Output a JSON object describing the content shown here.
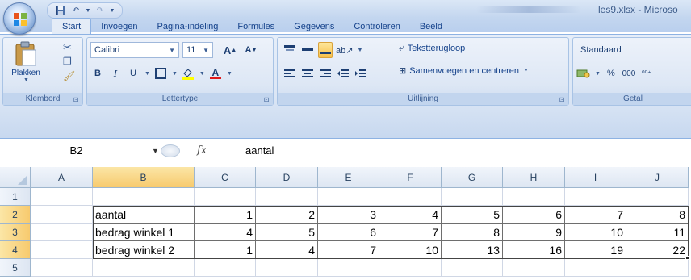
{
  "window": {
    "title": "les9.xlsx - Microso"
  },
  "tabs": [
    {
      "label": "Start",
      "active": true
    },
    {
      "label": "Invoegen",
      "active": false
    },
    {
      "label": "Pagina-indeling",
      "active": false
    },
    {
      "label": "Formules",
      "active": false
    },
    {
      "label": "Gegevens",
      "active": false
    },
    {
      "label": "Controleren",
      "active": false
    },
    {
      "label": "Beeld",
      "active": false
    }
  ],
  "ribbon": {
    "clipboard": {
      "paste_label": "Plakken",
      "group_label": "Klembord"
    },
    "font": {
      "font_name": "Calibri",
      "font_size": "11",
      "group_label": "Lettertype"
    },
    "alignment": {
      "wrap_label": "Terugloop",
      "wrap_prefix": "Tekst",
      "merge_label": "Samenvoegen en centreren",
      "group_label": "Uitlijning"
    },
    "number": {
      "format": "Standaard",
      "percent": "%",
      "thousands": "000",
      "group_label": "Getal"
    }
  },
  "formula_bar": {
    "name_box": "B2",
    "fx_label": "fx",
    "value": "aantal"
  },
  "sheet": {
    "columns": [
      "A",
      "B",
      "C",
      "D",
      "E",
      "F",
      "G",
      "H",
      "I",
      "J"
    ],
    "rows": [
      "1",
      "2",
      "3",
      "4",
      "5"
    ],
    "selected_column": "B",
    "selected_rows": [
      "2",
      "3",
      "4"
    ],
    "cells": {
      "B2": "aantal",
      "C2": "1",
      "D2": "2",
      "E2": "3",
      "F2": "4",
      "G2": "5",
      "H2": "6",
      "I2": "7",
      "J2": "8",
      "B3": "bedrag winkel 1",
      "C3": "4",
      "D3": "5",
      "E3": "6",
      "F3": "7",
      "G3": "8",
      "H3": "9",
      "I3": "10",
      "J3": "11",
      "B4": "bedrag winkel 2",
      "C4": "1",
      "D4": "4",
      "E4": "7",
      "F4": "10",
      "G4": "13",
      "H4": "16",
      "I4": "19",
      "J4": "22"
    }
  },
  "colors": {
    "accent": "#15428b",
    "header_selected": "#f7ca6e",
    "ribbon_bg": "#dbe6f5"
  }
}
